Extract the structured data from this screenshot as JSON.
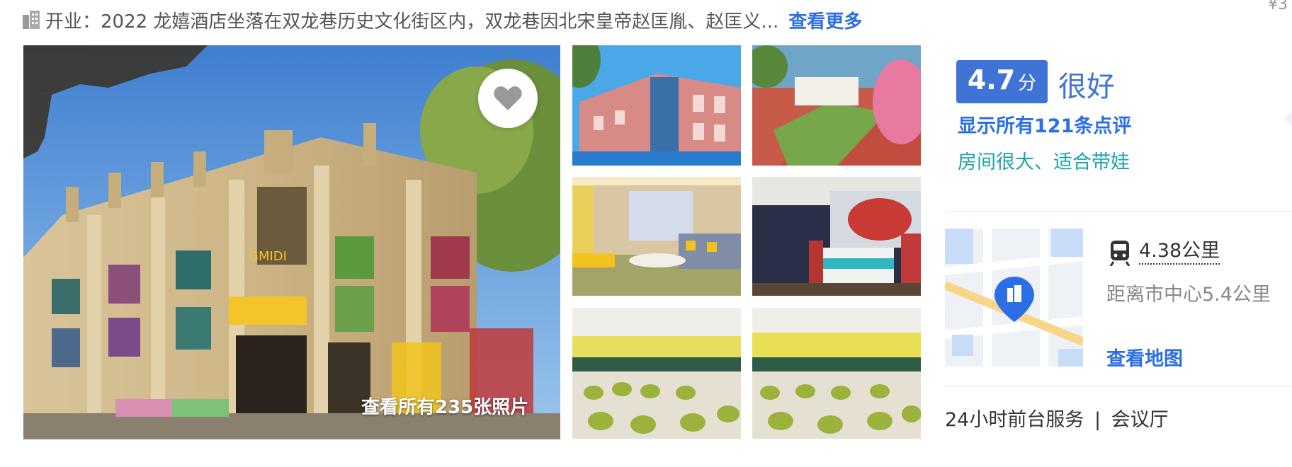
{
  "info": {
    "opening_text": "开业：2022  龙嬉酒店坐落在双龙巷历史文化街区内，双龙巷因北宋皇帝赵匡胤、赵匡义...",
    "see_more": "查看更多",
    "corner_price": "¥3"
  },
  "gallery": {
    "all_photos": "查看所有235张照片",
    "main_sign": "GMIDI",
    "thumbnails": [
      {
        "name": "exterior-building"
      },
      {
        "name": "courtyard-mural"
      },
      {
        "name": "living-room"
      },
      {
        "name": "bedroom"
      },
      {
        "name": "dining-hall-1"
      },
      {
        "name": "dining-hall-2"
      }
    ]
  },
  "rating": {
    "score": "4.7",
    "unit": "分",
    "label": "很好",
    "reviews_link": "显示所有121条点评",
    "tags": "房间很大、适合带娃"
  },
  "location": {
    "station_distance": "4.38公里",
    "center_distance": "距离市中心5.4公里",
    "view_map": "查看地图"
  },
  "facilities": {
    "items": [
      "24小时前台服务",
      "会议厅"
    ],
    "separator": "|"
  },
  "colors": {
    "accent_blue": "#2c6ee5",
    "score_badge": "#3f73d6",
    "tag_teal": "#1aa5a6"
  },
  "icons": {
    "building": "building-icon",
    "heart": "heart-icon",
    "train": "train-icon",
    "map_pin": "map-pin-icon"
  }
}
